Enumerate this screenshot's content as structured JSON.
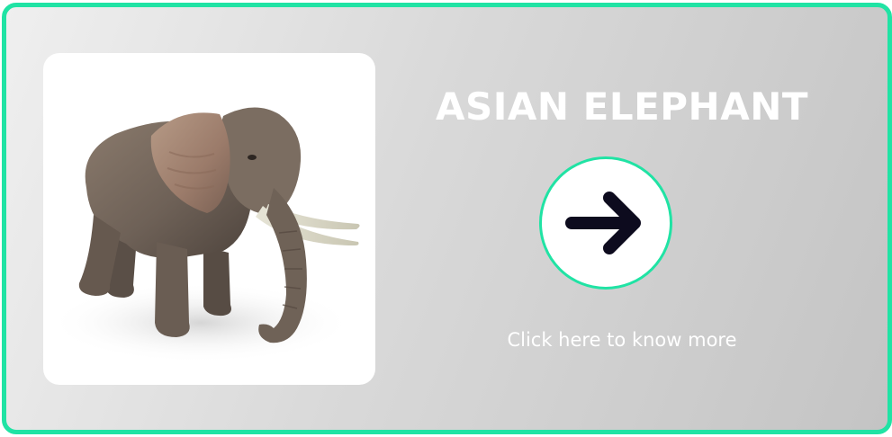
{
  "card": {
    "title": "ASIAN ELEPHANT",
    "image_subject": "elephant-photo",
    "link_text": "Click here to know more",
    "arrow_icon": "arrow-right-icon"
  },
  "colors": {
    "accent": "#20e3a4",
    "arrow": "#0d0b1e",
    "text": "#ffffff"
  }
}
